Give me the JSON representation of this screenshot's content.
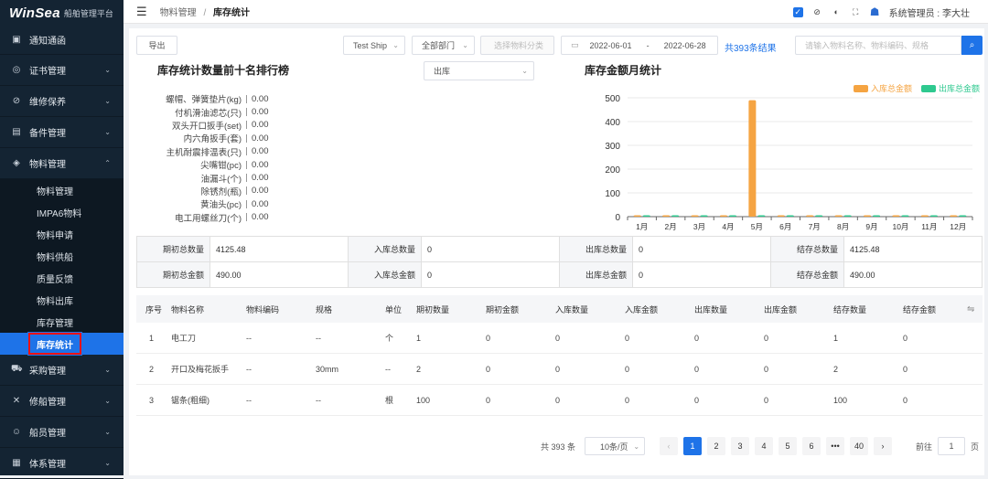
{
  "app": {
    "brand": "WinSea",
    "subtitle": "船舶管理平台"
  },
  "sidebar": {
    "items": [
      {
        "label": "通知通函",
        "icon": "notice-icon",
        "expanded": false
      },
      {
        "label": "证书管理",
        "icon": "certificate-icon",
        "expanded": false
      },
      {
        "label": "维修保养",
        "icon": "maintenance-icon",
        "expanded": false
      },
      {
        "label": "备件管理",
        "icon": "parts-icon",
        "expanded": false
      },
      {
        "label": "物料管理",
        "icon": "material-icon",
        "expanded": true
      }
    ],
    "sub_items": [
      "物料管理",
      "IMPA6物料",
      "物料申请",
      "物料供船",
      "质量反馈",
      "物料出库",
      "库存管理",
      "库存统计"
    ],
    "active_sub": "库存统计",
    "items_after": [
      {
        "label": "采购管理",
        "icon": "cart-icon"
      },
      {
        "label": "修船管理",
        "icon": "repair-icon"
      },
      {
        "label": "船员管理",
        "icon": "crew-icon"
      },
      {
        "label": "体系管理",
        "icon": "system-icon"
      }
    ]
  },
  "topbar": {
    "breadcrumb": [
      "物料管理",
      "库存统计"
    ],
    "user": "系统管理员 : 李大壮"
  },
  "toolbar": {
    "export_label": "导出",
    "ship": "Test Ship",
    "dept": "全部部门",
    "category_placeholder": "选择物料分类",
    "date_start": "2022-06-01",
    "date_sep": "-",
    "date_end": "2022-06-28",
    "result_text": "共393条结果",
    "search_placeholder": "请输入物料名称、物料编码、规格"
  },
  "ranking": {
    "title": "库存统计数量前十名排行榜",
    "type_select": "出库",
    "items": [
      {
        "label": "螺帽、弹簧垫片(kg)",
        "value": "0.00"
      },
      {
        "label": "付机滑油滤芯(只)",
        "value": "0.00"
      },
      {
        "label": "双头开口扳手(set)",
        "value": "0.00"
      },
      {
        "label": "内六角扳手(套)",
        "value": "0.00"
      },
      {
        "label": "主机耐震排温表(只)",
        "value": "0.00"
      },
      {
        "label": "尖嘴钳(pc)",
        "value": "0.00"
      },
      {
        "label": "油漏斗(个)",
        "value": "0.00"
      },
      {
        "label": "除锈剂(瓶)",
        "value": "0.00"
      },
      {
        "label": "黄油头(pc)",
        "value": "0.00"
      },
      {
        "label": "电工用螺丝刀(个)",
        "value": "0.00"
      }
    ]
  },
  "chart_data": {
    "type": "bar",
    "title": "库存金额月统计",
    "categories": [
      "1月",
      "2月",
      "3月",
      "4月",
      "5月",
      "6月",
      "7月",
      "8月",
      "9月",
      "10月",
      "11月",
      "12月"
    ],
    "series": [
      {
        "name": "入库总金额",
        "color": "#f5a442",
        "values": [
          0,
          0,
          0,
          0,
          490,
          0,
          0,
          0,
          0,
          0,
          0,
          0
        ]
      },
      {
        "name": "出库总金额",
        "color": "#2ec98f",
        "values": [
          0,
          0,
          0,
          0,
          0,
          0,
          0,
          0,
          0,
          0,
          0,
          0
        ]
      }
    ],
    "yticks": [
      "0",
      "100",
      "200",
      "300",
      "400",
      "500"
    ],
    "ylim": [
      0,
      500
    ],
    "legend": "top-right",
    "grid": true
  },
  "summary": {
    "rows": [
      [
        {
          "k": "期初总数量",
          "v": "4125.48"
        },
        {
          "k": "入库总数量",
          "v": "0"
        },
        {
          "k": "出库总数量",
          "v": "0"
        },
        {
          "k": "结存总数量",
          "v": "4125.48"
        }
      ],
      [
        {
          "k": "期初总金额",
          "v": "490.00"
        },
        {
          "k": "入库总金额",
          "v": "0"
        },
        {
          "k": "出库总金额",
          "v": "0"
        },
        {
          "k": "结存总金额",
          "v": "490.00"
        }
      ]
    ]
  },
  "table": {
    "headers": [
      "序号",
      "物料名称",
      "物料编码",
      "规格",
      "单位",
      "期初数量",
      "期初金额",
      "入库数量",
      "入库金额",
      "出库数量",
      "出库金额",
      "结存数量",
      "结存金额"
    ],
    "rows": [
      [
        "1",
        "电工刀",
        "--",
        "--",
        "个",
        "1",
        "0",
        "0",
        "0",
        "0",
        "0",
        "1",
        "0"
      ],
      [
        "2",
        "开口及梅花扳手",
        "--",
        "30mm",
        "--",
        "2",
        "0",
        "0",
        "0",
        "0",
        "0",
        "2",
        "0"
      ],
      [
        "3",
        "锯条(粗细)",
        "--",
        "--",
        "根",
        "100",
        "0",
        "0",
        "0",
        "0",
        "0",
        "100",
        "0"
      ]
    ]
  },
  "pagination": {
    "total": "共 393 条",
    "page_size": "10条/页",
    "pages": [
      "1",
      "2",
      "3",
      "4",
      "5",
      "6",
      "•••",
      "40"
    ],
    "current": "1",
    "goto_label": "前往",
    "goto_value": "1",
    "page_suffix": "页"
  }
}
